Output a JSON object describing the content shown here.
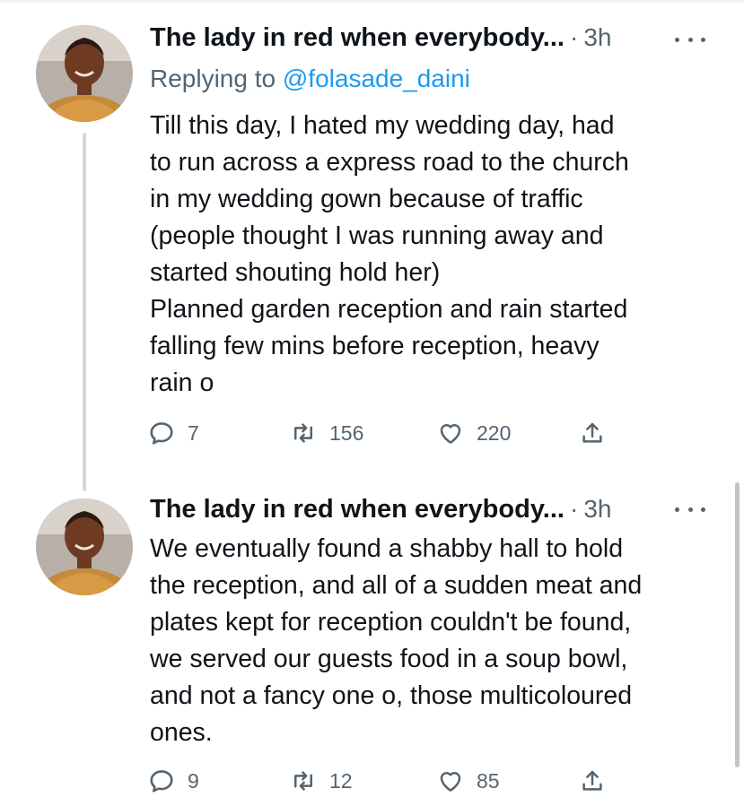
{
  "tweets": [
    {
      "author": "The lady in red when everybody...",
      "separator": "·",
      "time": "3h",
      "reply_prefix": "Replying to ",
      "reply_handle": "@folasade_daini",
      "lines": [
        "Till this day, I hated my wedding day, had",
        "to run across a express road to the church",
        "in my wedding gown because of traffic",
        "(people thought I was running away and",
        "started shouting hold her)",
        "Planned garden reception and rain started",
        "falling few mins before reception, heavy",
        "rain o"
      ],
      "replies": "7",
      "retweets": "156",
      "likes": "220"
    },
    {
      "author": "The lady in red when everybody...",
      "separator": "·",
      "time": "3h",
      "lines": [
        "We eventually found a shabby hall to hold",
        "the reception, and all of a sudden meat and",
        "plates kept for reception couldn't be found,",
        "we served our guests food in a soup bowl,",
        "and not a fancy one o, those multicoloured",
        "ones."
      ],
      "replies": "9",
      "retweets": "12",
      "likes": "85"
    }
  ],
  "icons": [
    "reply-icon",
    "retweet-icon",
    "like-icon",
    "share-icon",
    "more-icon"
  ],
  "colors": {
    "text": "#0f1419",
    "muted": "#536471",
    "link": "#1d9bf0",
    "thread_line": "#cfd9de"
  }
}
